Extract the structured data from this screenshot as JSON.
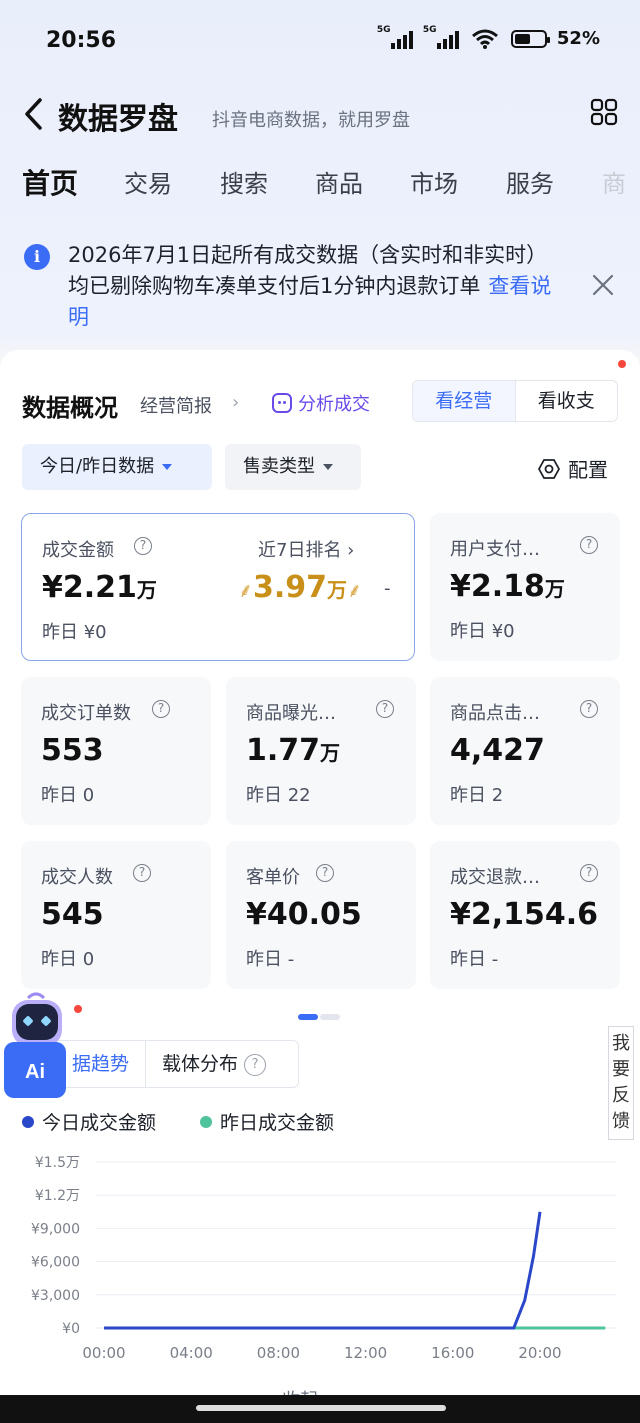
{
  "status": {
    "time": "20:56",
    "network1": "5G",
    "network2": "5G",
    "battery": "52%"
  },
  "header": {
    "title": "数据罗盘",
    "subtitle": "抖音电商数据，就用罗盘"
  },
  "tabs": [
    {
      "label": "首页",
      "active": true
    },
    {
      "label": "交易"
    },
    {
      "label": "搜索"
    },
    {
      "label": "商品"
    },
    {
      "label": "市场"
    },
    {
      "label": "服务"
    },
    {
      "label": "商"
    }
  ],
  "notice": {
    "text": "2026年7月1日起所有成交数据（含实时和非实时）均已剔除购物车凑单支付后1分钟内退款订单",
    "link": "查看说明"
  },
  "overview": {
    "title": "数据概况",
    "report_link": "经营简报",
    "report_arrow": "›",
    "analyze": "分析成交",
    "view_ops": "看经营",
    "view_finance": "看收支",
    "filter_date": "今日/昨日数据",
    "filter_type": "售卖类型",
    "config": "配置"
  },
  "cards": [
    {
      "label": "成交金额",
      "value": "¥2.21",
      "unit": "万",
      "prev": "昨日 ¥0",
      "rank_label": "近7日排名 ›",
      "rank_value": "3.97",
      "rank_unit": "万",
      "rank_dash": "-"
    },
    {
      "label": "用户支付…",
      "value": "¥2.18",
      "unit": "万",
      "prev": "昨日 ¥0"
    },
    {
      "label": "成交订单数",
      "value": "553",
      "unit": "",
      "prev": "昨日 0"
    },
    {
      "label": "商品曝光…",
      "value": "1.77",
      "unit": "万",
      "prev": "昨日 22"
    },
    {
      "label": "商品点击…",
      "value": "4,427",
      "unit": "",
      "prev": "昨日 2"
    },
    {
      "label": "成交人数",
      "value": "545",
      "unit": "",
      "prev": "昨日 0"
    },
    {
      "label": "客单价",
      "value": "¥40.05",
      "unit": "",
      "prev": "昨日 -"
    },
    {
      "label": "成交退款…",
      "value": "¥2,154.6",
      "unit": "",
      "prev": "昨日 -"
    }
  ],
  "chart_tabs": {
    "trend": "据趋势",
    "carrier": "载体分布",
    "q": "?"
  },
  "legend": {
    "today": "今日成交金额",
    "yesterday": "昨日成交金额"
  },
  "colors": {
    "today": "#2a46c9",
    "yesterday": "#4fc39c",
    "accent": "#3b6cf5"
  },
  "chart_data": {
    "type": "line",
    "x_ticks": [
      "00:00",
      "04:00",
      "08:00",
      "12:00",
      "16:00",
      "20:00"
    ],
    "y_ticks": [
      "¥0",
      "¥3,000",
      "¥6,000",
      "¥9,000",
      "¥1.2万",
      "¥1.5万"
    ],
    "ylim": [
      0,
      15000
    ],
    "xlim_hours": [
      0,
      23
    ],
    "series": [
      {
        "name": "今日成交金额",
        "points": [
          [
            0,
            0
          ],
          [
            18.8,
            0
          ],
          [
            19.3,
            2500
          ],
          [
            19.7,
            6500
          ],
          [
            20,
            10500
          ]
        ]
      },
      {
        "name": "昨日成交金额",
        "points": [
          [
            0,
            0
          ],
          [
            23,
            0
          ]
        ]
      }
    ]
  },
  "ai_label": "Ai",
  "feedback": [
    "我",
    "要",
    "反",
    "馈"
  ],
  "collapse": "收起"
}
